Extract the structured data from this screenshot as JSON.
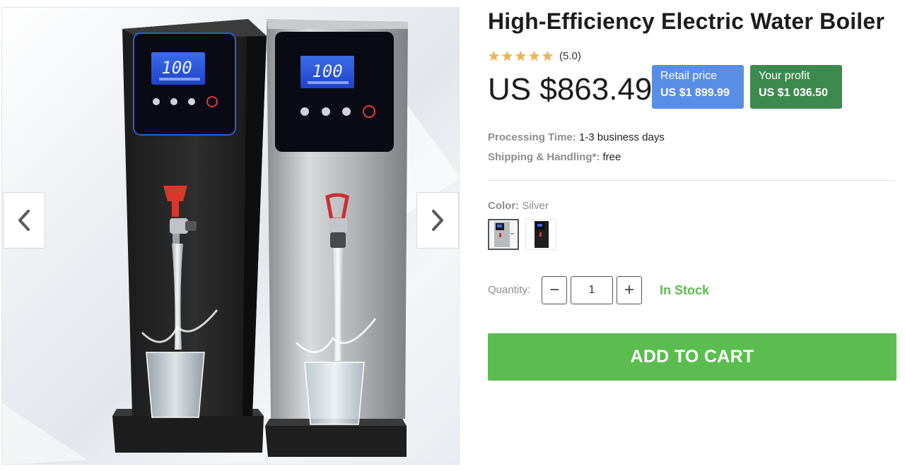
{
  "product": {
    "title": "High-Efficiency Electric Water Boiler",
    "rating_text": "(5.0)",
    "rating_value": 5,
    "rating_max": 5,
    "price": "US $863.49",
    "retail": {
      "label": "Retail price",
      "value": "US $1 899.99"
    },
    "profit": {
      "label": "Your profit",
      "value": "US $1 036.50"
    }
  },
  "info": {
    "processing_label": "Processing Time:",
    "processing_value": "1-3 business days",
    "shipping_label": "Shipping & Handling*:",
    "shipping_value": "free"
  },
  "color": {
    "label": "Color:",
    "selected": "Silver",
    "options": [
      "silver-boiler-swatch",
      "black-boiler-swatch"
    ]
  },
  "quantity": {
    "label": "Quantity:",
    "value": "1",
    "minus": "−",
    "plus": "+",
    "stock": "In Stock"
  },
  "cart": {
    "label": "ADD TO CART"
  },
  "gallery": {
    "display_text": "100",
    "icons": [
      "chevron-left-icon",
      "chevron-right-icon",
      "star-icon"
    ]
  },
  "colors": {
    "accent_green": "#5bbd4f",
    "retail_blue": "#5a8de6",
    "profit_green": "#3e8a4e",
    "star_orange": "#f0b35a"
  }
}
